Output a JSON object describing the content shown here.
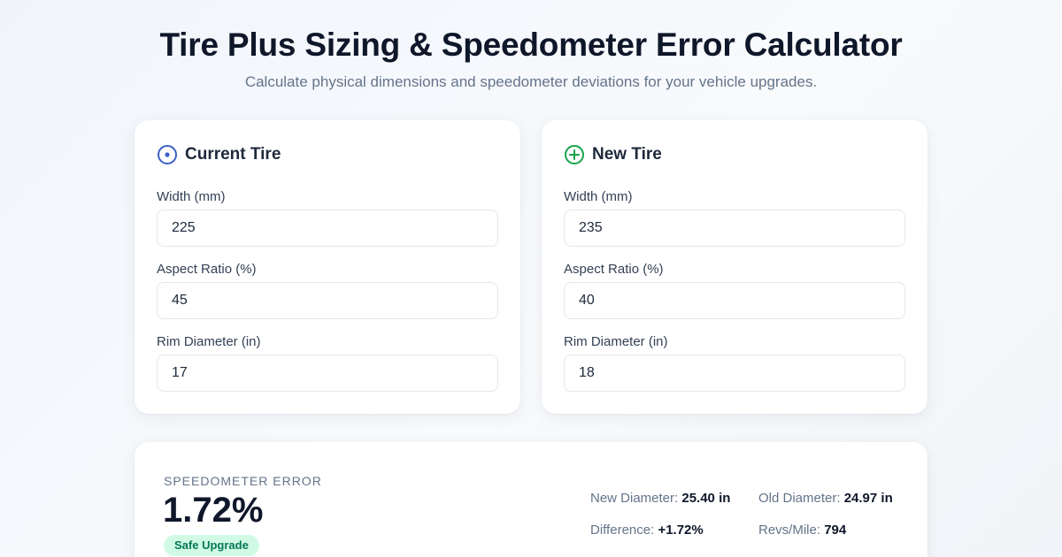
{
  "header": {
    "title": "Tire Plus Sizing & Speedometer Error Calculator",
    "subtitle": "Calculate physical dimensions and speedometer deviations for your vehicle upgrades."
  },
  "current_tire": {
    "title": "Current Tire",
    "icon": "target-circle-icon",
    "icon_color": "#3b5fc4",
    "width_label": "Width (mm)",
    "width_value": "225",
    "aspect_label": "Aspect Ratio (%)",
    "aspect_value": "45",
    "rim_label": "Rim Diameter (in)",
    "rim_value": "17"
  },
  "new_tire": {
    "title": "New Tire",
    "icon": "plus-circle-icon",
    "icon_color": "#16a34a",
    "width_label": "Width (mm)",
    "width_value": "235",
    "aspect_label": "Aspect Ratio (%)",
    "aspect_value": "40",
    "rim_label": "Rim Diameter (in)",
    "rim_value": "18"
  },
  "results": {
    "error_label": "Speedometer Error",
    "error_value": "1.72%",
    "badge": "Safe Upgrade",
    "badge_color": "#047857",
    "new_diameter_label": "New Diameter:",
    "new_diameter_value": "25.40 in",
    "old_diameter_label": "Old Diameter:",
    "old_diameter_value": "24.97 in",
    "difference_label": "Difference:",
    "difference_value": "+1.72%",
    "revs_label": "Revs/Mile:",
    "revs_value": "794"
  }
}
